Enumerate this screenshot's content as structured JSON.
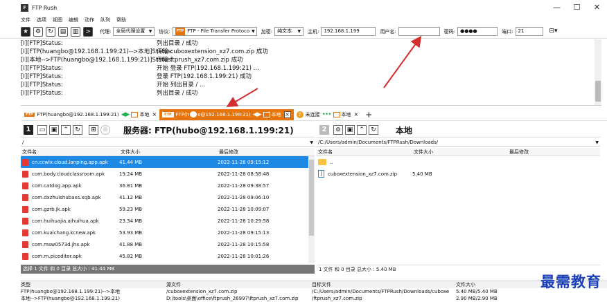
{
  "window": {
    "title": "FTP Rush",
    "controls": [
      "—",
      "☐",
      "✕"
    ]
  },
  "menu": [
    "文件",
    "选项",
    "视图",
    "编辑",
    "动作",
    "队列",
    "帮助"
  ],
  "toolbar": {
    "proxy_label": "代理:",
    "proxy_value": "全局代理设置",
    "protocol_label": "协议:",
    "protocol_value": "FTP - File Transfer Protoco",
    "encrypt_label": "加密:",
    "encrypt_value": "纯文本",
    "host_label": "主机:",
    "host_value": "192.168.1.199",
    "user_label": "用户名:",
    "user_value": "",
    "password_label": "密码:",
    "password_value": "●●●●",
    "port_label": "端口:",
    "port_value": "21"
  },
  "log": [
    {
      "src": "[I][FTP]Status:",
      "msg": "列出目录 / 成功"
    },
    {
      "src": "[I][FTP(huangbo@192.168.1.199:21)-->本地]Status:",
      "msg": "传输 cuboxextension_xz7.com.zip 成功"
    },
    {
      "src": "[I][本地-->FTP(huangbo@192.168.1.199:21)]Status:",
      "msg": "传输 ftprush_xz7.com.zip 成功"
    },
    {
      "src": "[I][FTP]Status:",
      "msg": "开始 登录 FTP(192.168.1.199:21) ..."
    },
    {
      "src": "[I][FTP]Status:",
      "msg": "登录 FTP(192.168.1.199:21) 成功"
    },
    {
      "src": "[I][FTP]Status:",
      "msg": "开始 列出目录 / ..."
    },
    {
      "src": "[I][FTP]Status:",
      "msg": "列出目录 / 成功"
    }
  ],
  "tabs": {
    "tab1": {
      "left": "FTP(huangbo@192.168.1.199:21)",
      "right": "本地"
    },
    "tab2": {
      "left": "FTP(h",
      "left_rest": "o@192.168.1.199:21)",
      "right": "本地"
    },
    "tab3": {
      "left": "未连接",
      "right": "本地"
    }
  },
  "left_pane": {
    "number": "1",
    "title": "服务器: FTP(hubo@192.168.1.199:21)",
    "path": "/",
    "columns": [
      "文件名",
      "文件大小",
      "最后修改"
    ],
    "files": [
      {
        "name": "cn.ccwlx.cloud.lanping.app.apk",
        "size": "41.44 MB",
        "date": "2022-11-28 09:15:12"
      },
      {
        "name": "com.body.cloudclassroom.apk",
        "size": "19.24 MB",
        "date": "2022-11-28 08:58:48"
      },
      {
        "name": "com.catdog.app.apk",
        "size": "36.81 MB",
        "date": "2022-11-28 09:38:57"
      },
      {
        "name": "com.dxzhuishubaxs.xqb.apk",
        "size": "41.12 MB",
        "date": "2022-11-28 09:06:10"
      },
      {
        "name": "com.gzrb.jk.apk",
        "size": "59.23 MB",
        "date": "2022-11-28 10:09:07"
      },
      {
        "name": "com.huihuajia.aihuihua.apk",
        "size": "23.34 MB",
        "date": "2022-11-28 10:29:58"
      },
      {
        "name": "com.kuaichang.kcnew.apk",
        "size": "53.93 MB",
        "date": "2022-11-28 09:15:13"
      },
      {
        "name": "com.msw0573d.jhx.apk",
        "size": "41.88 MB",
        "date": "2022-11-28 10:15:58"
      },
      {
        "name": "com.rn.piceditor.apk",
        "size": "45.82 MB",
        "date": "2022-11-28 10:01:26"
      }
    ],
    "status": "选择 1 文件 和 0 目录 总大小 : 41.44 MB"
  },
  "right_pane": {
    "number": "2",
    "title": "本地",
    "path": "/C:/Users/admin/Documents/FTPRush/Downloads/",
    "columns": [
      "文件名",
      "文件大小",
      "最后修改"
    ],
    "files": [
      {
        "name": "..",
        "size": "",
        "date": ""
      },
      {
        "name": "cuboxextension_xz7.com.zip",
        "size": "5.40 MB",
        "date": ""
      }
    ],
    "status": "1 文件 和 0 目录 总大小 : 5.40 MB"
  },
  "queue": {
    "columns": [
      "类型",
      "源文件",
      "目标文件",
      "文件大小"
    ],
    "rows": [
      {
        "type": "FTP(huangbo@192.168.1.199:21)-->本地",
        "src": "/cuboxextension_xz7.com.zip",
        "dst": "/C:/Users/admin/Documents/FTPRush/Downloads/cuboxe",
        "size": "5.40 MB/5.40 MB"
      },
      {
        "type": "本地-->FTP(huangbo@192.168.1.199:21)",
        "src": "D:\\tools\\桌面\\office\\ftprush_26997\\ftprush_xz7.com.zip",
        "dst": "/ftprush_xz7.com.zip",
        "size": "2.90 MB/2.90 MB"
      }
    ]
  },
  "watermark": "最需教育",
  "colors": {
    "accent": "#e8740c",
    "selection": "#1e88e5",
    "annotation_arrow": "#d32f2f",
    "watermark": "#1a3fb8"
  }
}
